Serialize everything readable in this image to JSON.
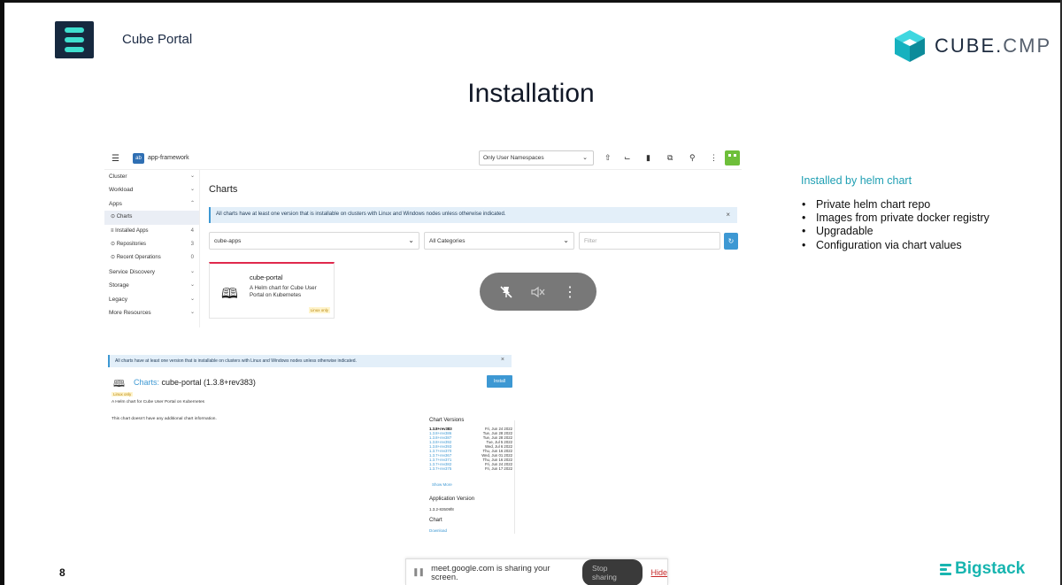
{
  "header": {
    "brand": "Cube Portal",
    "logo_text": "CUBE.",
    "logo_text_suffix": "CMP",
    "slide_title": "Installation"
  },
  "screenshot1": {
    "cluster_name": "app-framework",
    "cluster_icon_text": "ab",
    "namespace_select": "Only User Namespaces",
    "sidebar": [
      {
        "label": "Cluster",
        "type": "group"
      },
      {
        "label": "Workload",
        "type": "group"
      },
      {
        "label": "Apps",
        "type": "group"
      },
      {
        "label": "Charts",
        "type": "sub",
        "count": ""
      },
      {
        "label": "Installed Apps",
        "type": "sub",
        "count": "4"
      },
      {
        "label": "Repositories",
        "type": "sub",
        "count": "3"
      },
      {
        "label": "Recent Operations",
        "type": "sub",
        "count": "0"
      },
      {
        "label": "Service Discovery",
        "type": "group"
      },
      {
        "label": "Storage",
        "type": "group"
      },
      {
        "label": "Legacy",
        "type": "group"
      },
      {
        "label": "More Resources",
        "type": "group"
      }
    ],
    "heading": "Charts",
    "banner": "All charts have at least one version that is installable on clusters with Linux and Windows nodes unless otherwise indicated.",
    "repo_select": "cube-apps",
    "category_select": "All Categories",
    "filter_placeholder": "Filter",
    "card": {
      "title": "cube-portal",
      "description": "A Helm chart for Cube User Portal on Kubernetes",
      "badge": "Linux only"
    }
  },
  "screenshot2": {
    "banner": "All charts have at least one version that is installable on clusters with Linux and Windows nodes unless otherwise indicated.",
    "title_link": "Charts:",
    "title_rest": "cube-portal (1.3.8+rev383)",
    "badge": "Linux only",
    "install_label": "Install",
    "description": "A Helm chart for Cube User Portal on Kubernetes",
    "no_info": "This chart doesn't have any additional chart information.",
    "versions_heading": "Chart Versions",
    "versions": [
      {
        "version": "1.3.8+rev383",
        "date": "Fri, Jun 24 2022",
        "current": true
      },
      {
        "version": "1.3.8+rev386",
        "date": "Tue, Jun 28 2022",
        "current": false
      },
      {
        "version": "1.3.8+rev387",
        "date": "Tue, Jun 28 2022",
        "current": false
      },
      {
        "version": "1.3.8+rev392",
        "date": "Tue, Jul 5 2022",
        "current": false
      },
      {
        "version": "1.3.8+rev393",
        "date": "Wed, Jul 6 2022",
        "current": false
      },
      {
        "version": "1.3.7+rev370",
        "date": "Thu, Jun 16 2022",
        "current": false
      },
      {
        "version": "1.3.7+rev367",
        "date": "Wed, Jun 01 2022",
        "current": false
      },
      {
        "version": "1.3.7+rev371",
        "date": "Thu, Jun 16 2022",
        "current": false
      },
      {
        "version": "1.3.7+rev382",
        "date": "Fri, Jun 24 2022",
        "current": false
      },
      {
        "version": "1.3.7+rev375",
        "date": "Fri, Jun 17 2022",
        "current": false
      }
    ],
    "show_more": "Show More",
    "app_version_heading": "Application Version",
    "app_version": "1.3.2-83509f8",
    "chart_heading": "Chart",
    "download_label": "Download"
  },
  "right_panel": {
    "label": "Installed by helm chart",
    "bullets": [
      "Private helm chart repo",
      "Images from private docker registry",
      "Upgradable",
      "Configuration via chart values"
    ]
  },
  "footer": {
    "page_number": "8",
    "share_text": "meet.google.com is sharing your screen.",
    "stop_sharing": "Stop sharing",
    "hide": "Hide",
    "bigstack": "Bigstack"
  },
  "colors": {
    "accent_teal": "#1f9fb3",
    "bigstack_teal": "#18b5b0",
    "link_blue": "#3d98d3",
    "logo_bg": "#16293f",
    "card_top": "#e0294d"
  },
  "icons": {
    "overlay": [
      "pin-off-icon",
      "mute-icon",
      "more-vertical-icon"
    ],
    "toolbar": [
      "upload-icon",
      "terminal-icon",
      "file-icon",
      "copy-icon",
      "search-icon",
      "avatar"
    ]
  }
}
